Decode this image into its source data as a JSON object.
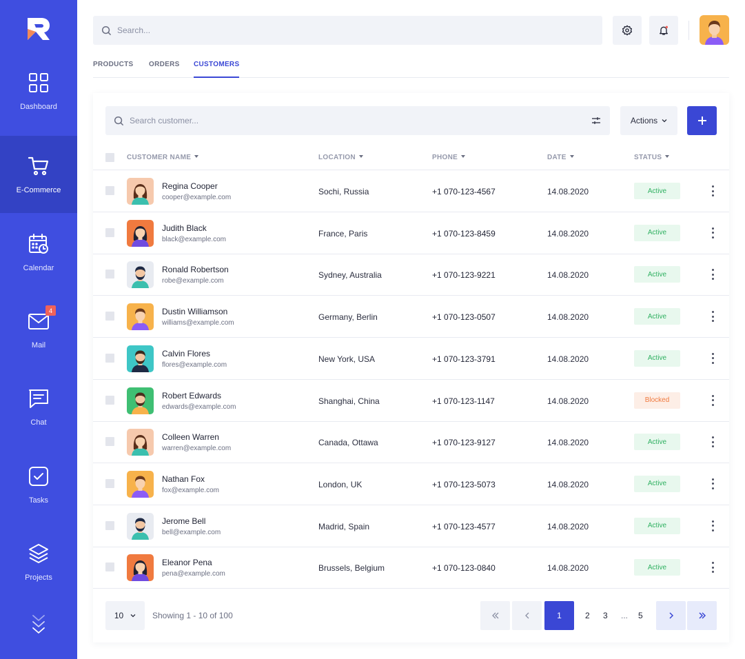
{
  "sidebar": {
    "items": [
      {
        "label": "Dashboard",
        "icon": "grid-icon"
      },
      {
        "label": "E-Commerce",
        "icon": "cart-icon"
      },
      {
        "label": "Calendar",
        "icon": "calendar-icon"
      },
      {
        "label": "Mail",
        "icon": "mail-icon",
        "badge": "4"
      },
      {
        "label": "Chat",
        "icon": "chat-icon"
      },
      {
        "label": "Tasks",
        "icon": "check-icon"
      },
      {
        "label": "Projects",
        "icon": "layers-icon"
      }
    ],
    "active_index": 1
  },
  "header": {
    "search_placeholder": "Search..."
  },
  "tabs": [
    {
      "label": "PRODUCTS"
    },
    {
      "label": "ORDERS"
    },
    {
      "label": "CUSTOMERS",
      "active": true
    }
  ],
  "toolbar": {
    "search_placeholder": "Search customer...",
    "actions_label": "Actions"
  },
  "table": {
    "columns": [
      "CUSTOMER NAME",
      "LOCATION",
      "PHONE",
      "DATE",
      "STATUS"
    ],
    "rows": [
      {
        "name": "Regina Cooper",
        "email": "cooper@example.com",
        "location": "Sochi, Russia",
        "phone": "+1 070-123-4567",
        "date": "14.08.2020",
        "status": "Active"
      },
      {
        "name": "Judith Black",
        "email": "black@example.com",
        "location": "France, Paris",
        "phone": "+1 070-123-8459",
        "date": "14.08.2020",
        "status": "Active"
      },
      {
        "name": "Ronald Robertson",
        "email": "robe@example.com",
        "location": "Sydney, Australia",
        "phone": "+1 070-123-9221",
        "date": "14.08.2020",
        "status": "Active"
      },
      {
        "name": "Dustin Williamson",
        "email": "williams@example.com",
        "location": "Germany, Berlin",
        "phone": "+1 070-123-0507",
        "date": "14.08.2020",
        "status": "Active"
      },
      {
        "name": "Calvin Flores",
        "email": "flores@example.com",
        "location": "New York, USA",
        "phone": "+1 070-123-3791",
        "date": "14.08.2020",
        "status": "Active"
      },
      {
        "name": "Robert Edwards",
        "email": "edwards@example.com",
        "location": "Shanghai, China",
        "phone": "+1 070-123-1147",
        "date": "14.08.2020",
        "status": "Blocked"
      },
      {
        "name": "Colleen Warren",
        "email": "warren@example.com",
        "location": "Canada, Ottawa",
        "phone": "+1 070-123-9127",
        "date": "14.08.2020",
        "status": "Active"
      },
      {
        "name": "Nathan Fox",
        "email": "fox@example.com",
        "location": "London, UK",
        "phone": "+1 070-123-5073",
        "date": "14.08.2020",
        "status": "Active"
      },
      {
        "name": "Jerome Bell",
        "email": "bell@example.com",
        "location": "Madrid, Spain",
        "phone": "+1 070-123-4577",
        "date": "14.08.2020",
        "status": "Active"
      },
      {
        "name": "Eleanor Pena",
        "email": "pena@example.com",
        "location": "Brussels, Belgium",
        "phone": "+1 070-123-0840",
        "date": "14.08.2020",
        "status": "Active"
      }
    ]
  },
  "footer": {
    "per_page": "10",
    "showing": "Showing 1 - 10 of 100",
    "pages": [
      "1",
      "2",
      "3",
      "...",
      "5"
    ],
    "current_page": "1"
  },
  "colors": {
    "sidebar": "#3f4ee0",
    "sidebar_active": "#3342c4",
    "accent": "#3a47d5",
    "status_active_text": "#2fb061",
    "status_blocked_text": "#f07a3f"
  }
}
